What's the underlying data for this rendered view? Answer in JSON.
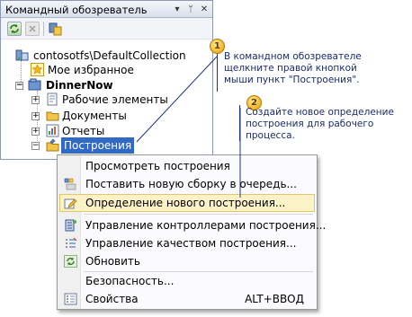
{
  "panel": {
    "title": "Командный обозреватель",
    "title_buttons": [
      "▾",
      "ᛘ",
      "✕"
    ]
  },
  "tree": {
    "collection": "contosotfs\\DefaultCollection",
    "favorites": "Мое избранное",
    "project": "DinnerNow",
    "work_items": "Рабочие элементы",
    "documents": "Документы",
    "reports": "Отчеты",
    "builds": "Построения"
  },
  "menu": {
    "items": [
      {
        "label": "Просмотреть построения",
        "shortcut": ""
      },
      {
        "label": "Поставить новую сборку в очередь...",
        "shortcut": ""
      },
      {
        "label": "Определение нового построения...",
        "shortcut": ""
      },
      {
        "label": "Управление контроллерами построения...",
        "shortcut": ""
      },
      {
        "label": "Управление качеством построения...",
        "shortcut": ""
      },
      {
        "label": "Обновить",
        "shortcut": ""
      },
      {
        "label": "Безопасность...",
        "shortcut": ""
      },
      {
        "label": "Свойства",
        "shortcut": "ALT+ВВОД"
      }
    ],
    "highlighted_index": 2
  },
  "callouts": [
    {
      "number": "1",
      "lines": [
        "В командном обозревателе",
        "щелкните правой кнопкой",
        "мыши пункт \"Построения\"."
      ]
    },
    {
      "number": "2",
      "lines": [
        "Создайте новое определение",
        "построения для рабочего",
        "процесса."
      ]
    }
  ],
  "colors": {
    "selection": "#3169c6",
    "highlight_bg": "#fcf2c8",
    "callout_text": "#1a2c6b",
    "callout_line": "#1b3480"
  }
}
